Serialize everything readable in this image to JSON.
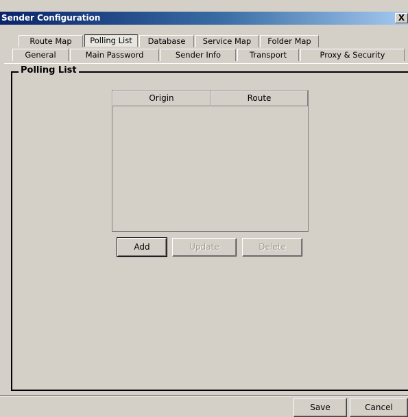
{
  "window": {
    "title": "Sender Configuration",
    "close_glyph": "X",
    "close_icon": "close-icon"
  },
  "tabs": {
    "back_row": [
      {
        "label": "Route Map",
        "active": false
      },
      {
        "label": "Polling List",
        "active": true
      },
      {
        "label": "Database",
        "active": false
      },
      {
        "label": "Service Map",
        "active": false
      },
      {
        "label": "Folder Map",
        "active": false
      }
    ],
    "front_row": [
      {
        "label": "General",
        "active": false
      },
      {
        "label": "Main Password",
        "active": false
      },
      {
        "label": "Sender Info",
        "active": false
      },
      {
        "label": "Transport",
        "active": false
      },
      {
        "label": "Proxy & Security",
        "active": false
      }
    ]
  },
  "polling_list": {
    "group_title": "Polling List",
    "columns": [
      "Origin",
      "Route"
    ],
    "rows": [],
    "buttons": {
      "add": "Add",
      "update": "Update",
      "delete": "Delete"
    },
    "disabled": [
      "update",
      "delete"
    ]
  },
  "footer": {
    "save": "Save",
    "cancel": "Cancel"
  },
  "colors": {
    "face": "#d4d0c8",
    "title_start": "#0a246a",
    "title_end": "#a6caf0",
    "disabled_text": "#9d9a92"
  }
}
